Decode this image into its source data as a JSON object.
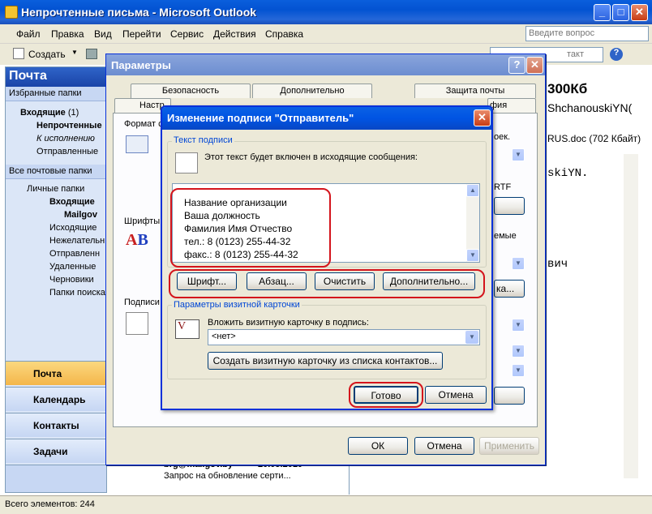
{
  "window": {
    "title": "Непрочтенные письма - Microsoft Outlook",
    "min": "_",
    "max": "□",
    "close": "✕"
  },
  "menu": [
    "Файл",
    "Правка",
    "Вид",
    "Перейти",
    "Сервис",
    "Действия",
    "Справка"
  ],
  "help_placeholder": "Введите вопрос",
  "toolbar": {
    "create": "Создать",
    "contact_fragment": "такт"
  },
  "nav": {
    "title": "Почта",
    "favorites_header": "Избранные папки",
    "favorites": [
      {
        "label": "Входящие",
        "count": "(1)",
        "bold": true
      },
      {
        "label": "Непрочтенные",
        "count": "",
        "bold": true
      },
      {
        "label": "К исполнению",
        "count": "",
        "bold": false
      },
      {
        "label": "Отправленные",
        "count": "",
        "bold": false
      }
    ],
    "all_header": "Все почтовые папки",
    "tree": [
      "Личные папки",
      "Входящие",
      "Mailgov",
      "Исходящие",
      "Нежелательн",
      "Отправленн",
      "Удаленные",
      "Черновики",
      "Папки поиска"
    ],
    "buttons": [
      "Почта",
      "Календарь",
      "Контакты",
      "Задачи"
    ]
  },
  "reading": {
    "size": "300Кб",
    "from": "ShchanouskiYN(",
    "attach": "RUS.doc (702 Кбайт)",
    "body1": "skiYN.",
    "body2": "вич"
  },
  "maillist": {
    "from": "brg@mailgov.by",
    "date": "20.05.2010",
    "subject": "Запрос на обновление серти..."
  },
  "status": "Всего элементов: 244",
  "params": {
    "title": "Параметры",
    "help": "?",
    "close": "✕",
    "tabs_top": [
      "Безопасность",
      "Дополнительно",
      "Защита почты"
    ],
    "tabs_bottom": [
      "Настр",
      "фия"
    ],
    "labels": {
      "format": "Формат с",
      "fonts": "Шрифты",
      "signature": "Подписи",
      "right1": "оек.",
      "right2": "RTF",
      "right3": "емые",
      "right_btn": "ка..."
    },
    "ok": "ОК",
    "cancel": "Отмена",
    "apply": "Применить"
  },
  "sig": {
    "title": "Изменение подписи \"Отправитель\"",
    "close": "✕",
    "text_group": "Текст подписи",
    "info": "Этот текст будет включен в исходящие сообщения:",
    "lines": [
      "Название организации",
      "Ваша должность",
      "Фамилия Имя Отчество",
      "тел.: 8 (0123) 255-44-32",
      "факс.: 8 (0123) 255-44-32"
    ],
    "buttons": [
      "Шрифт...",
      "Абзац...",
      "Очистить",
      "Дополнительно..."
    ],
    "vcard_group": "Параметры визитной карточки",
    "vcard_label": "Вложить визитную карточку в подпись:",
    "vcard_value": "<нет>",
    "vcard_create": "Создать визитную карточку из списка контактов...",
    "done": "Готово",
    "cancel": "Отмена"
  }
}
